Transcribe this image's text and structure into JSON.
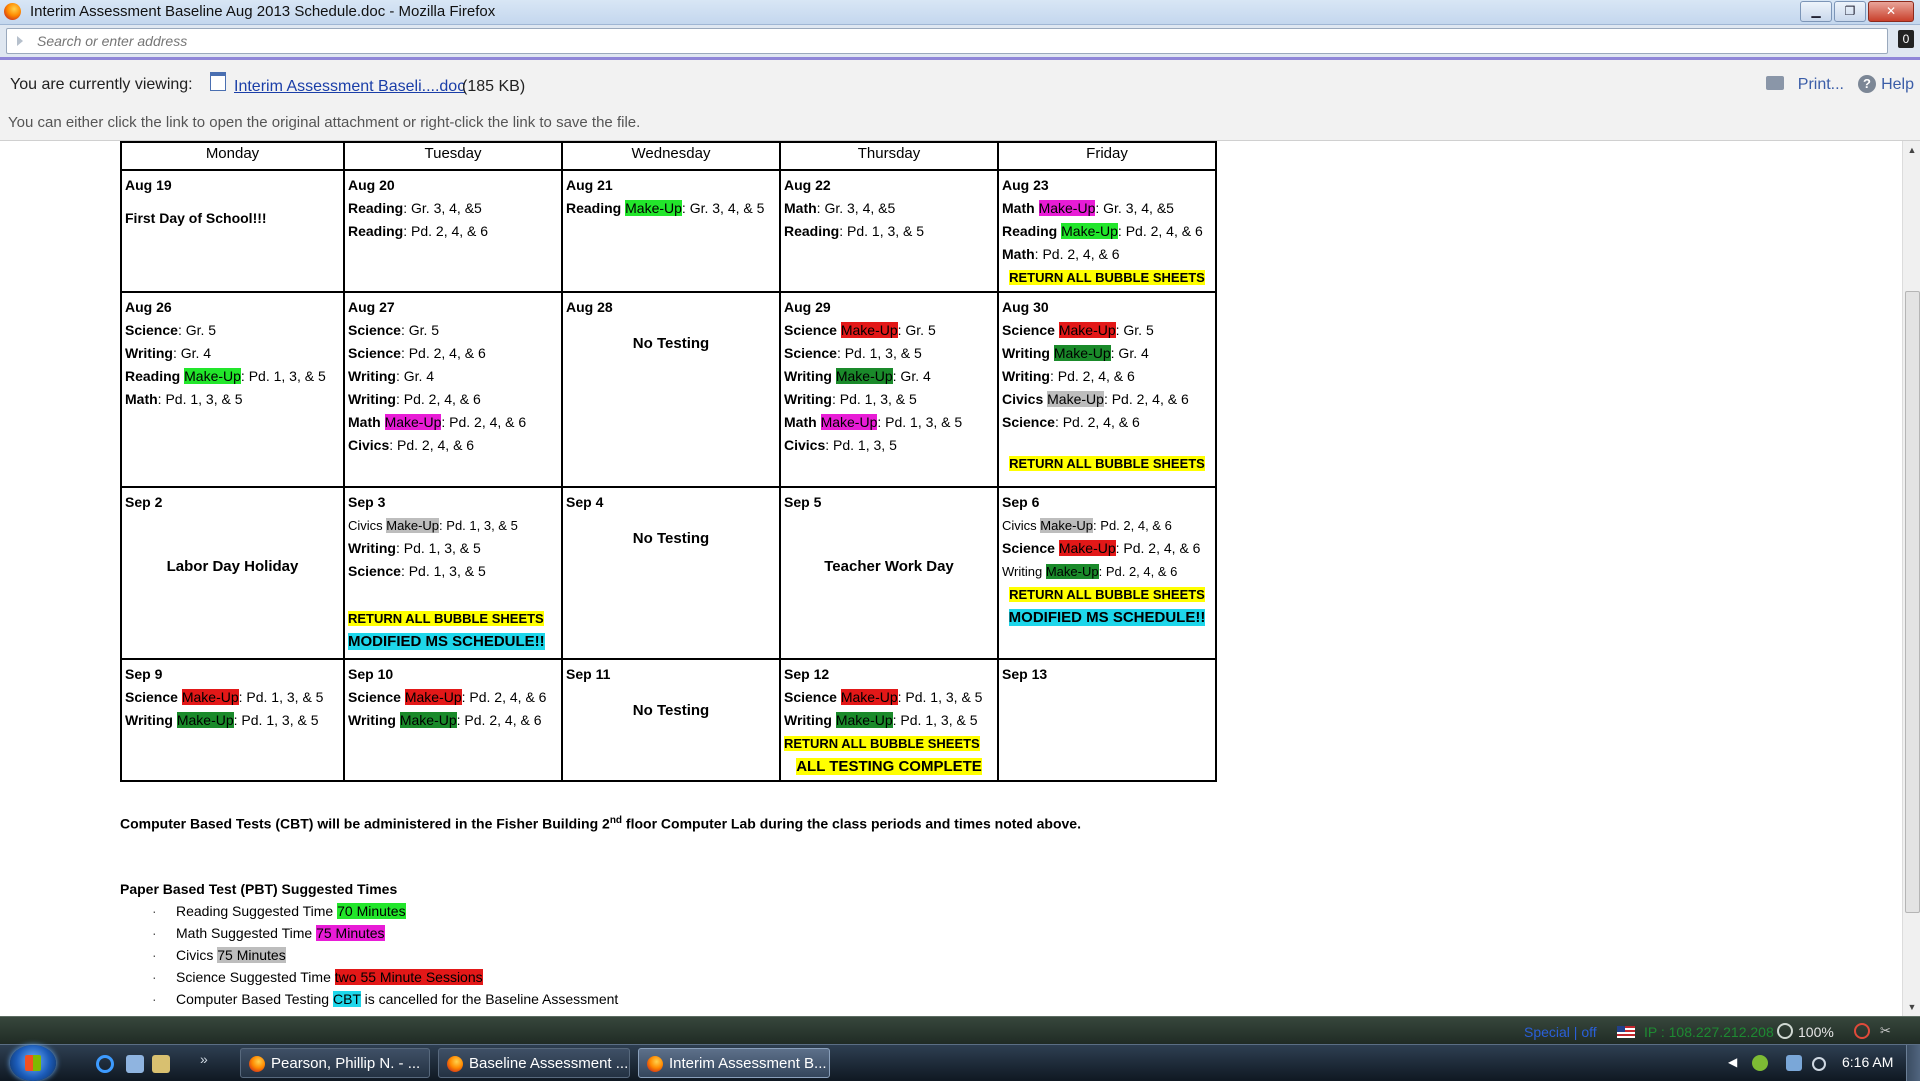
{
  "window": {
    "title": "Interim Assessment Baseline Aug 2013 Schedule.doc - Mozilla Firefox",
    "minimize": "▁",
    "maximize": "❐",
    "close": "✕"
  },
  "address_bar": {
    "placeholder": "Search or enter address",
    "tab_count": "0"
  },
  "viewer": {
    "viewing_label": "You are currently viewing:",
    "file_link": "Interim Assessment Baseli....doc",
    "file_size": "(185 KB)",
    "print_label": "Print...",
    "help_label": "Help",
    "info_text": "You can either click the link to open the original attachment or right-click the link to save the file."
  },
  "calendar": {
    "headers": [
      "Monday",
      "Tuesday",
      "Wednesday",
      "Thursday",
      "Friday"
    ],
    "week1": {
      "mon_date": "Aug 19",
      "mon_note": "First Day of School!!!",
      "tue_date": "Aug 20",
      "tue_l1_subj": "Reading",
      "tue_l1_rest": ": Gr. 3, 4, &5",
      "tue_l2_subj": "Reading",
      "tue_l2_rest": ": Pd. 2, 4, & 6",
      "wed_date": "Aug 21",
      "wed_l1_subj": "Reading",
      "wed_l1_hl": "Make-Up",
      "wed_l1_rest": ": Gr. 3, 4, & 5",
      "thu_date": "Aug 22",
      "thu_l1_subj": "Math",
      "thu_l1_rest": ": Gr. 3, 4, &5",
      "thu_l2_subj": "Reading",
      "thu_l2_rest": ": Pd. 1, 3, & 5",
      "fri_date": "Aug 23",
      "fri_l1_subj": "Math",
      "fri_l1_hl": "Make-Up",
      "fri_l1_rest": ": Gr. 3, 4, &5",
      "fri_l2_subj": "Reading",
      "fri_l2_hl": "Make-Up",
      "fri_l2_rest": ": Pd. 2, 4, & 6",
      "fri_l3_subj": "Math",
      "fri_l3_rest": ": Pd. 2, 4, & 6",
      "fri_bubble": "RETURN ALL BUBBLE SHEETS"
    },
    "week2": {
      "mon_date": "Aug 26",
      "mon_l1_subj": "Science",
      "mon_l1_rest": ": Gr. 5",
      "mon_l2_subj": "Writing",
      "mon_l2_rest": ": Gr. 4",
      "mon_l3_subj": "Reading",
      "mon_l3_hl": "Make-Up",
      "mon_l3_rest": ": Pd. 1, 3, & 5",
      "mon_l4_subj": "Math",
      "mon_l4_rest": ": Pd. 1, 3, & 5",
      "tue_date": "Aug 27",
      "tue_l1_subj": "Science",
      "tue_l1_rest": ": Gr. 5",
      "tue_l2_subj": "Science",
      "tue_l2_rest": ": Pd. 2, 4, & 6",
      "tue_l3_subj": "Writing",
      "tue_l3_rest": ": Gr. 4",
      "tue_l4_subj": "Writing",
      "tue_l4_rest": ": Pd. 2, 4, & 6",
      "tue_l5_subj": "Math",
      "tue_l5_hl": "Make-Up",
      "tue_l5_rest": ": Pd. 2, 4, & 6",
      "tue_l6_subj": "Civics",
      "tue_l6_rest": ": Pd. 2, 4, & 6",
      "wed_date": "Aug 28",
      "wed_note": "No Testing",
      "thu_date": "Aug 29",
      "thu_l1_subj": "Science",
      "thu_l1_hl": "Make-Up",
      "thu_l1_rest": ": Gr. 5",
      "thu_l2_subj": "Science",
      "thu_l2_rest": ": Pd. 1, 3, & 5",
      "thu_l3_subj": "Writing",
      "thu_l3_hl": "Make-Up",
      "thu_l3_rest": ": Gr. 4",
      "thu_l4_subj": "Writing",
      "thu_l4_rest": ": Pd. 1, 3, & 5",
      "thu_l5_subj": "Math",
      "thu_l5_hl": "Make-Up",
      "thu_l5_rest": ": Pd. 1, 3, & 5",
      "thu_l6_subj": "Civics",
      "thu_l6_rest": ": Pd. 1, 3, 5",
      "fri_date": "Aug 30",
      "fri_l1_subj": "Science",
      "fri_l1_hl": "Make-Up",
      "fri_l1_rest": ": Gr. 5",
      "fri_l2_subj": "Writing",
      "fri_l2_hl": "Make-Up",
      "fri_l2_rest": ": Gr. 4",
      "fri_l3_subj": "Writing",
      "fri_l3_rest": ": Pd. 2, 4, & 6",
      "fri_l4_subj": "Civics",
      "fri_l4_hl": "Make-Up",
      "fri_l4_rest": ": Pd. 2, 4, & 6",
      "fri_l5_subj": "Science",
      "fri_l5_rest": ": Pd. 2, 4, & 6",
      "fri_bubble": "RETURN ALL BUBBLE SHEETS"
    },
    "week3": {
      "mon_date": "Sep 2",
      "mon_note": "Labor Day Holiday",
      "tue_date": "Sep 3",
      "tue_l1_subj": "Civics",
      "tue_l1_hl": "Make-Up",
      "tue_l1_rest": ": Pd. 1, 3, & 5",
      "tue_l2_subj": "Writing",
      "tue_l2_rest": ": Pd. 1, 3, & 5",
      "tue_l3_subj": "Science",
      "tue_l3_rest": ": Pd. 1, 3, & 5",
      "tue_bubble": "RETURN ALL BUBBLE SHEETS",
      "tue_modified": "MODIFIED MS SCHEDULE!!",
      "wed_date": "Sep 4",
      "wed_note": "No Testing",
      "thu_date": "Sep 5",
      "thu_note": "Teacher Work Day",
      "fri_date": "Sep 6",
      "fri_l1_subj": "Civics",
      "fri_l1_hl": "Make-Up",
      "fri_l1_rest": ": Pd. 2, 4, & 6",
      "fri_l2_subj": "Science",
      "fri_l2_hl": "Make-Up",
      "fri_l2_rest": ": Pd. 2, 4, & 6",
      "fri_l3_subj": "Writing",
      "fri_l3_hl": "Make-Up",
      "fri_l3_rest": ": Pd. 2, 4, & 6",
      "fri_bubble": "RETURN ALL BUBBLE SHEETS",
      "fri_modified": "MODIFIED MS SCHEDULE!!"
    },
    "week4": {
      "mon_date": "Sep 9",
      "mon_l1_subj": "Science",
      "mon_l1_hl": "Make-Up",
      "mon_l1_rest": ": Pd. 1, 3, & 5",
      "mon_l2_subj": "Writing",
      "mon_l2_hl": "Make-Up",
      "mon_l2_rest": ": Pd. 1, 3, & 5",
      "tue_date": "Sep 10",
      "tue_l1_subj": "Science",
      "tue_l1_hl": "Make-Up",
      "tue_l1_rest": ": Pd. 2, 4, & 6",
      "tue_l2_subj": "Writing",
      "tue_l2_hl": "Make-Up",
      "tue_l2_rest": ": Pd. 2, 4, & 6",
      "wed_date": "Sep 11",
      "wed_note": "No Testing",
      "thu_date": "Sep 12",
      "thu_l1_subj": "Science",
      "thu_l1_hl": "Make-Up",
      "thu_l1_rest": ": Pd. 1, 3, & 5",
      "thu_l2_subj": "Writing",
      "thu_l2_hl": "Make-Up",
      "thu_l2_rest": ": Pd. 1, 3, & 5",
      "thu_bubble": "RETURN ALL BUBBLE SHEETS",
      "thu_complete": "ALL TESTING COMPLETE",
      "fri_date": "Sep 13"
    }
  },
  "notes": {
    "cbt_part1": "Computer Based Tests (CBT) will be administered in the Fisher Building 2",
    "cbt_sup": "nd",
    "cbt_part2": " floor Computer Lab during the class periods and times noted above.",
    "pbt_heading": "Paper Based Test (PBT) Suggested Times",
    "bullet": "·",
    "pbt": [
      {
        "text": "Reading Suggested Time ",
        "hl": "70 Minutes",
        "after": ""
      },
      {
        "text": "Math Suggested Time ",
        "hl": "75 Minutes",
        "after": ""
      },
      {
        "text": "Civics ",
        "hl": "75 Minutes",
        "after": ""
      },
      {
        "text": "Science Suggested Time ",
        "hl": "two 55 Minute Sessions",
        "after": ""
      },
      {
        "text": "Computer Based Testing ",
        "hl": "CBT",
        "after": " is cancelled for the Baseline Assessment"
      }
    ]
  },
  "status_bar": {
    "special": "Special | off",
    "ip": "IP : 108.227.212.208",
    "zoom": "100%"
  },
  "taskbar": {
    "items": [
      "Pearson, Phillip N. - ...",
      "Baseline Assessment ...",
      "Interim Assessment B..."
    ],
    "more_glyph": "»",
    "time": "6:16 AM"
  },
  "colors": {
    "light_green": "#22e62b",
    "magenta": "#e81cd6",
    "red": "#e31818",
    "dark_green": "#1a8a2a",
    "gray": "#bdbdbd",
    "yellow": "#ffff00",
    "cyan": "#1ed6ea"
  }
}
